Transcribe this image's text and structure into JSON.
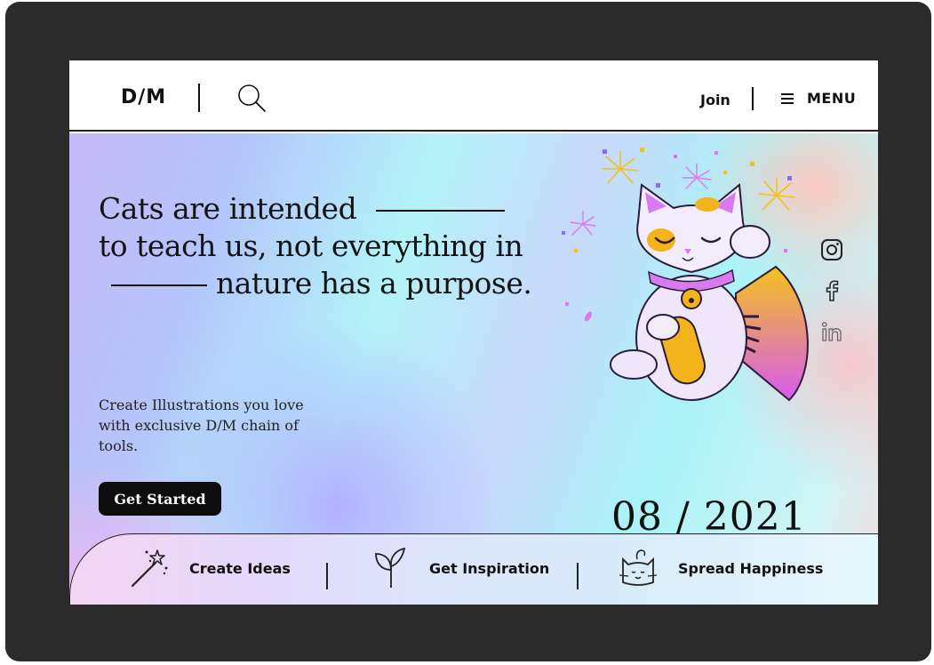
{
  "header": {
    "logo": "D/M",
    "join_label": "Join",
    "menu_label": "MENU"
  },
  "hero": {
    "headline": {
      "line1": "Cats are intended",
      "line2": "to teach us, not everything  in",
      "line3": "nature has a purpose."
    },
    "subtext": "Create Illustrations you love with exclusive D/M chain of tools.",
    "cta_label": "Get Started",
    "date": "08 / 2021"
  },
  "socials": [
    "instagram-icon",
    "facebook-icon",
    "linkedin-icon"
  ],
  "features": [
    {
      "icon": "magic-wand-icon",
      "label": "Create Ideas"
    },
    {
      "icon": "leaf-sprout-icon",
      "label": "Get Inspiration"
    },
    {
      "icon": "cat-face-icon",
      "label": "Spread Happiness"
    }
  ],
  "colors": {
    "frame": "#2b2b2b",
    "text": "#111111",
    "cta_bg": "#0d0d0d",
    "cat_pink": "#d97af0",
    "cat_orange": "#f2b31b"
  }
}
